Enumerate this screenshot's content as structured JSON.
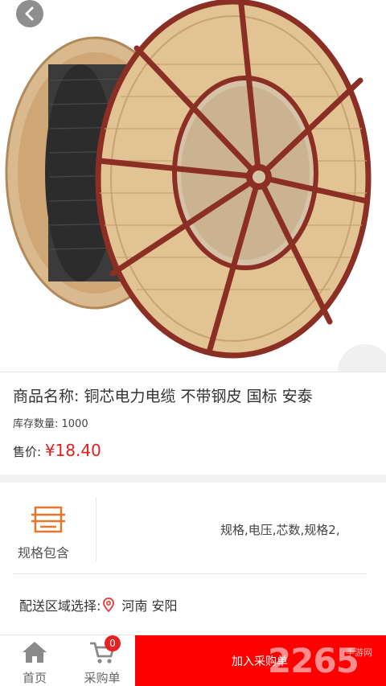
{
  "product": {
    "image_alt": "cable-drum-photo",
    "title_prefix": "商品名称: ",
    "title": "铜芯电力电缆 不带钢皮 国标 安泰",
    "stock_label": "库存数量: ",
    "stock_value": "1000",
    "price_label": "售价: ",
    "price_currency": "¥",
    "price_value": "18.40"
  },
  "specs": {
    "label": "规格包含",
    "values": "规格,电压,芯数,规格2,"
  },
  "delivery": {
    "label": "配送区域选择:",
    "region": "河南 安阳"
  },
  "bottom_bar": {
    "home_label": "首页",
    "cart_label": "采购单",
    "cart_count": "0",
    "add_button": "加入采购单"
  },
  "watermark": {
    "brand": "2265",
    "sub": "手游网"
  },
  "colors": {
    "accent_red": "#ff0000",
    "price_red": "#e02020",
    "spec_orange": "#e8752a"
  },
  "icons": [
    "back-arrow-icon",
    "spec-list-icon",
    "location-pin-icon",
    "home-icon",
    "cart-icon"
  ]
}
